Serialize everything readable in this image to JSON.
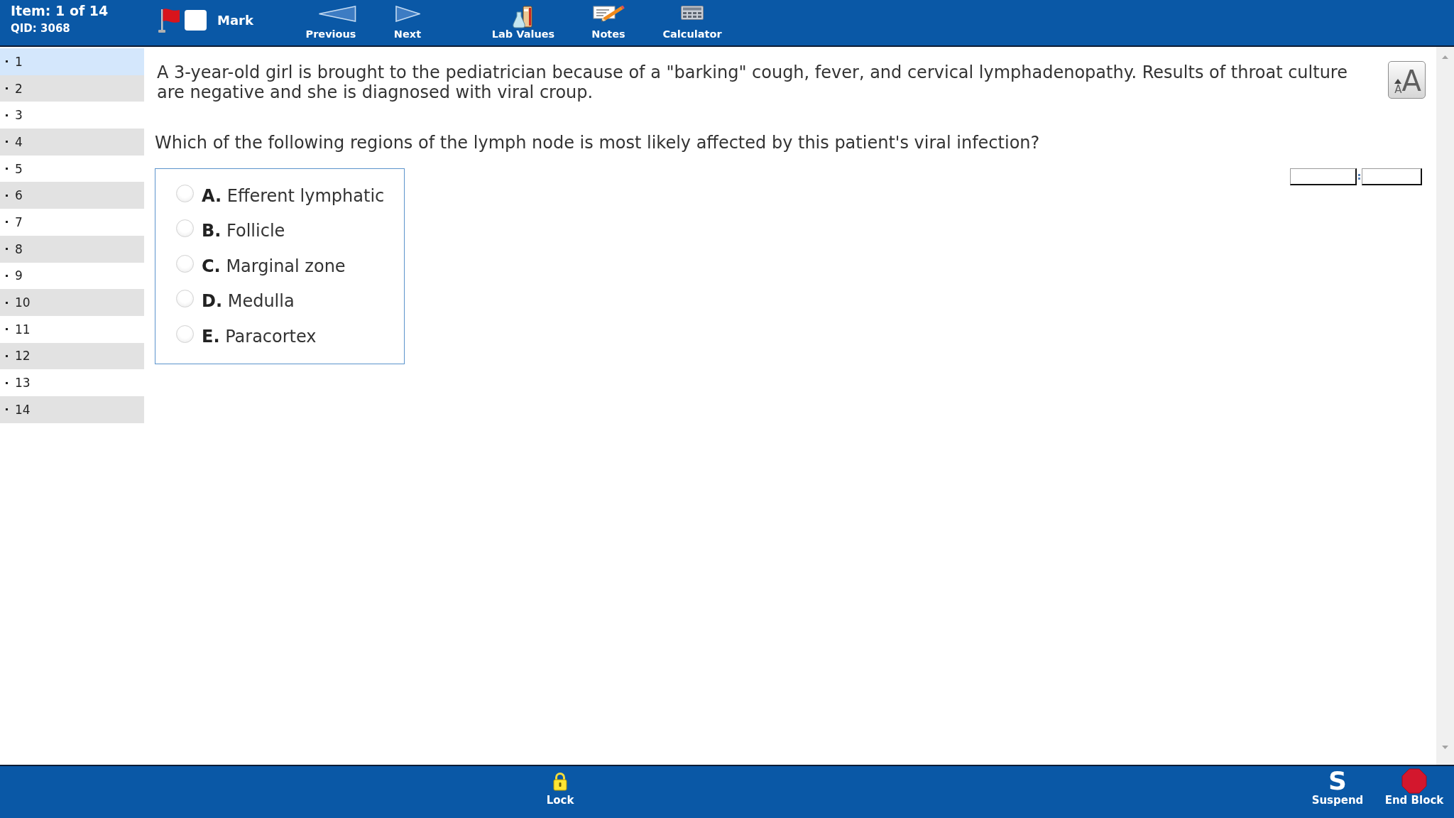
{
  "header": {
    "item_counter": "Item: 1 of 14",
    "qid": "QID: 3068",
    "mark": {
      "label": "Mark",
      "checked": false
    },
    "tools": [
      {
        "kind": "previous",
        "label": "Previous"
      },
      {
        "kind": "next",
        "label": "Next"
      },
      {
        "kind": "lab_values",
        "label": "Lab Values"
      },
      {
        "kind": "notes",
        "label": "Notes"
      },
      {
        "kind": "calculator",
        "label": "Calculator"
      }
    ]
  },
  "sidebar": {
    "items": [
      {
        "label": "1",
        "selected": true
      },
      {
        "label": "2",
        "selected": false
      },
      {
        "label": "3",
        "selected": false
      },
      {
        "label": "4",
        "selected": false
      },
      {
        "label": "5",
        "selected": false
      },
      {
        "label": "6",
        "selected": false
      },
      {
        "label": "7",
        "selected": false
      },
      {
        "label": "8",
        "selected": false
      },
      {
        "label": "9",
        "selected": false
      },
      {
        "label": "10",
        "selected": false
      },
      {
        "label": "11",
        "selected": false
      },
      {
        "label": "12",
        "selected": false
      },
      {
        "label": "13",
        "selected": false
      },
      {
        "label": "14",
        "selected": false
      }
    ]
  },
  "question": {
    "stem": "A 3-year-old girl is brought to the pediatrician because of a \"barking\" cough, fever, and cervical lymphadenopathy. Results of throat culture are negative and she is diagnosed with viral croup.",
    "text_size_button": {
      "small_letter": "A",
      "large_letter": "A"
    },
    "prompt": "Which of the following regions of the lymph node is most likely affected by this patient's viral infection?",
    "choices": [
      {
        "letter": "A.",
        "text": "Efferent lymphatic",
        "selected": false
      },
      {
        "letter": "B.",
        "text": "Follicle",
        "selected": false
      },
      {
        "letter": "C.",
        "text": "Marginal zone",
        "selected": false
      },
      {
        "letter": "D.",
        "text": "Medulla",
        "selected": false
      },
      {
        "letter": "E.",
        "text": "Paracortex",
        "selected": false
      }
    ]
  },
  "footer": {
    "buttons": [
      {
        "kind": "lock",
        "label": "Lock"
      },
      {
        "kind": "suspend",
        "glyph": "S",
        "label": "Suspend"
      },
      {
        "kind": "end_block",
        "label": "End Block"
      }
    ]
  }
}
